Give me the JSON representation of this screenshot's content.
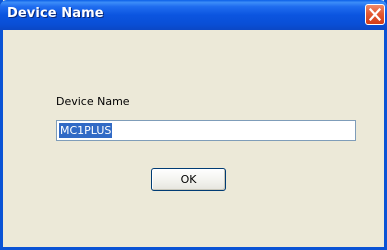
{
  "window": {
    "title": "Device Name",
    "close_icon": "close-icon"
  },
  "form": {
    "label": "Device Name",
    "input_value": "MC1PLUS"
  },
  "buttons": {
    "ok_label": "OK"
  },
  "colors": {
    "titlebar": "#0a53d5",
    "dialog_bg": "#ece9d8",
    "selection": "#316ac5",
    "close_button": "#e45a33"
  }
}
